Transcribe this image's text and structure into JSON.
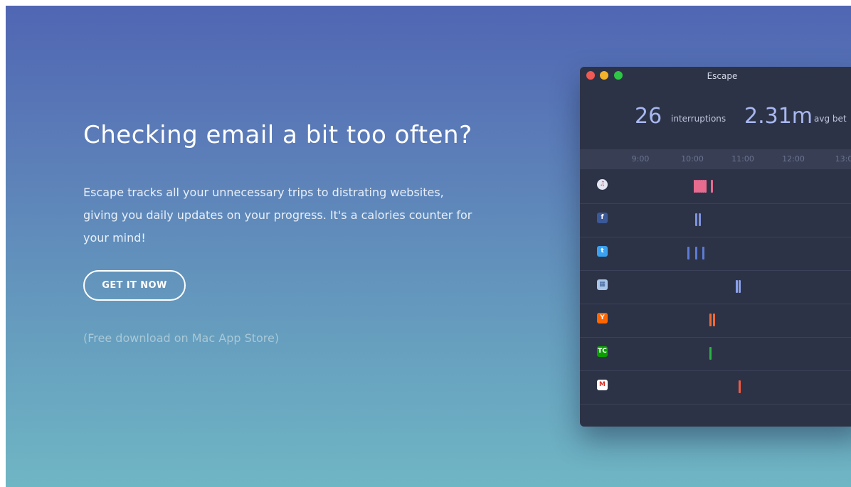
{
  "hero": {
    "title": "Checking email a bit too often?",
    "description": "Escape tracks all your unnecessary trips to distrating websites, giving you daily updates on your progress. It's a calories counter for your mind!",
    "cta_label": "GET IT NOW",
    "note": "(Free download on Mac App Store)"
  },
  "window": {
    "title": "Escape",
    "stats": [
      {
        "value": "26",
        "label": "interruptions"
      },
      {
        "value": "2.31m",
        "label": "avg bet"
      }
    ],
    "timeline": [
      "9:00",
      "10:00",
      "11:00",
      "12:00",
      "13:0"
    ],
    "rows": [
      {
        "site": "itunes",
        "icon_text": "♫",
        "color": "#e76b8f",
        "icon_bg": "#e4e7f2",
        "icon_fg": "#d5567d",
        "marks": [
          10.05,
          10.09,
          10.13,
          10.18,
          10.22,
          10.26,
          10.38
        ]
      },
      {
        "site": "facebook",
        "icon_text": "f",
        "color": "#7f92e0",
        "icon_bg": "#3b5998",
        "icon_fg": "#ffffff",
        "marks": [
          10.08,
          10.14
        ]
      },
      {
        "site": "twitter",
        "icon_text": "t",
        "color": "#5d7bd6",
        "icon_bg": "#3aa1f0",
        "icon_fg": "#ffffff",
        "marks": [
          9.92,
          10.07,
          10.22
        ]
      },
      {
        "site": "preview",
        "icon_text": "▦",
        "color": "#8aa0ea",
        "icon_bg": "#a9c5e8",
        "icon_fg": "#3c5f95",
        "marks": [
          10.88,
          10.93
        ]
      },
      {
        "site": "hacker-news",
        "icon_text": "Y",
        "color": "#f06a33",
        "icon_bg": "#ff6600",
        "icon_fg": "#ffffff",
        "marks": [
          10.36,
          10.42
        ]
      },
      {
        "site": "techcrunch",
        "icon_text": "TC",
        "color": "#27b443",
        "icon_bg": "#0a9e01",
        "icon_fg": "#ffffff",
        "marks": [
          10.35
        ]
      },
      {
        "site": "gmail",
        "icon_text": "M",
        "color": "#f15a3f",
        "icon_bg": "#ffffff",
        "icon_fg": "#d93025",
        "marks": [
          10.93
        ]
      }
    ]
  }
}
